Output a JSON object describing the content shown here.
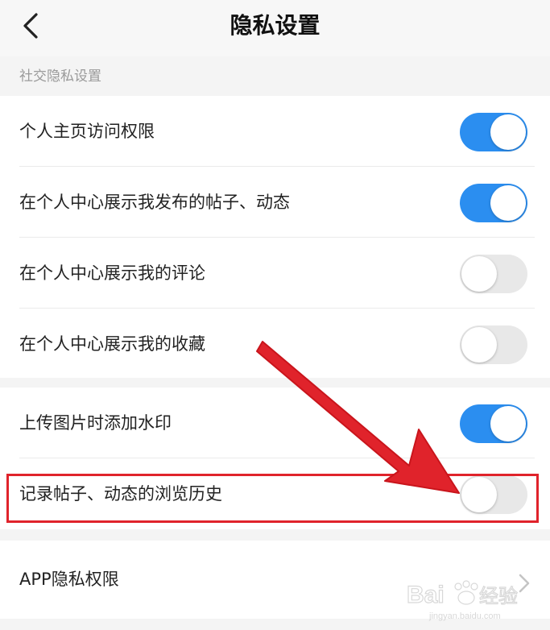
{
  "header": {
    "title": "隐私设置",
    "back_icon": "chevron-left-icon"
  },
  "section": {
    "label": "社交隐私设置"
  },
  "group1": {
    "items": [
      {
        "label": "个人主页访问权限",
        "enabled": true
      },
      {
        "label": "在个人中心展示我发布的帖子、动态",
        "enabled": true
      },
      {
        "label": "在个人中心展示我的评论",
        "enabled": false
      },
      {
        "label": "在个人中心展示我的收藏",
        "enabled": false
      }
    ]
  },
  "group2": {
    "items": [
      {
        "label": "上传图片时添加水印",
        "enabled": true
      },
      {
        "label": "记录帖子、动态的浏览历史",
        "enabled": false
      }
    ]
  },
  "group3": {
    "items": [
      {
        "label": "APP隐私权限",
        "icon": "chevron-right-icon"
      }
    ]
  },
  "colors": {
    "toggle_on": "#2b8ef0",
    "toggle_off": "#e8e8e8",
    "highlight": "#e0232b",
    "arrow": "#e0232b"
  },
  "watermark": {
    "brand": "Bai",
    "brand2": "du",
    "suffix": "经验",
    "url": "jingyan.baidu.com"
  }
}
